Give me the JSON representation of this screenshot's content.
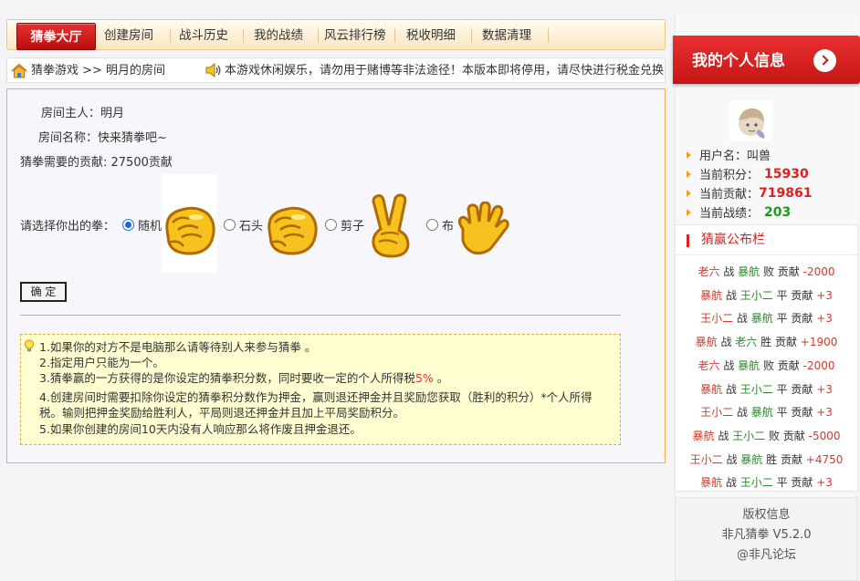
{
  "nav": {
    "active": "猜拳大厅",
    "items": [
      "创建房间",
      "战斗历史",
      "我的战绩",
      "风云排行榜",
      "税收明细",
      "数据清理"
    ]
  },
  "breadcrumb": {
    "path": "猜拳游戏 >> 明月的房间",
    "notice": "本游戏休闲娱乐，请勿用于赌博等非法途径！本版本即将停用，请尽快进行税金兑换"
  },
  "room": {
    "owner": "房间主人：明月",
    "name": "房间名称：快来猜拳吧~",
    "cost": "猜拳需要的贡献: 27500贡献",
    "choose_label": "请选择你出的拳：",
    "options": [
      "随机",
      "石头",
      "剪子",
      "布"
    ],
    "selected": "随机",
    "submit": "确 定"
  },
  "tips": {
    "line1": "1.如果你的对方不是电脑那么请等待别人来参与猜拳 。",
    "line2": "2.指定用户只能为一个。",
    "line3_a": "3.猜拳赢的一方获得的是你设定的猜拳积分数，同时要收一定的个人所得税",
    "line3_pct": "5%",
    "line3_b": " 。",
    "line4a": "4.创建房间时需要扣除你设定的猜拳积分数作为押金，赢则退还押金并且奖励您获取（胜利的积分）*个人所得",
    "line4b": "税。输则把押金奖励给胜利人，平局则退还押金并且加上平局奖励积分。",
    "line5": "5.如果你创建的房间10天内没有人响应那么将作废且押金退还。"
  },
  "profile": {
    "title": "我的个人信息",
    "username_label": "用户名：叫兽",
    "points_label": "当前积分：",
    "points": "15930",
    "contrib_label": "当前贡献：",
    "contrib": "719861",
    "record_label": "当前战绩：",
    "record": "203",
    "colors": {
      "points": "#e02020",
      "contrib": "#e02020",
      "record": "#1a9a1a"
    }
  },
  "board": {
    "title": "猜赢公布栏",
    "records": [
      {
        "p1": "老六",
        "p2": "暴航",
        "result": "败",
        "amount": "-2000"
      },
      {
        "p1": "暴航",
        "p2": "王小二",
        "result": "平",
        "amount": "+3"
      },
      {
        "p1": "王小二",
        "p2": "暴航",
        "result": "平",
        "amount": "+3"
      },
      {
        "p1": "暴航",
        "p2": "老六",
        "result": "胜",
        "amount": "+1900"
      },
      {
        "p1": "老六",
        "p2": "暴航",
        "result": "败",
        "amount": "-2000"
      },
      {
        "p1": "暴航",
        "p2": "王小二",
        "result": "平",
        "amount": "+3"
      },
      {
        "p1": "王小二",
        "p2": "暴航",
        "result": "平",
        "amount": "+3"
      },
      {
        "p1": "暴航",
        "p2": "王小二",
        "result": "败",
        "amount": "-5000"
      },
      {
        "p1": "王小二",
        "p2": "暴航",
        "result": "胜",
        "amount": "+4750"
      },
      {
        "p1": "暴航",
        "p2": "王小二",
        "result": "平",
        "amount": "+3"
      }
    ],
    "words": {
      "vs": "战",
      "contrib": "贡献"
    }
  },
  "copyright": {
    "title": "版权信息",
    "version": "非凡猜拳 V5.2.0",
    "site": "@非凡论坛"
  },
  "icons": [
    "home-icon",
    "speaker-icon",
    "bulb-icon",
    "fist-icon",
    "scissors-icon",
    "palm-icon",
    "arrow-right-icon"
  ]
}
